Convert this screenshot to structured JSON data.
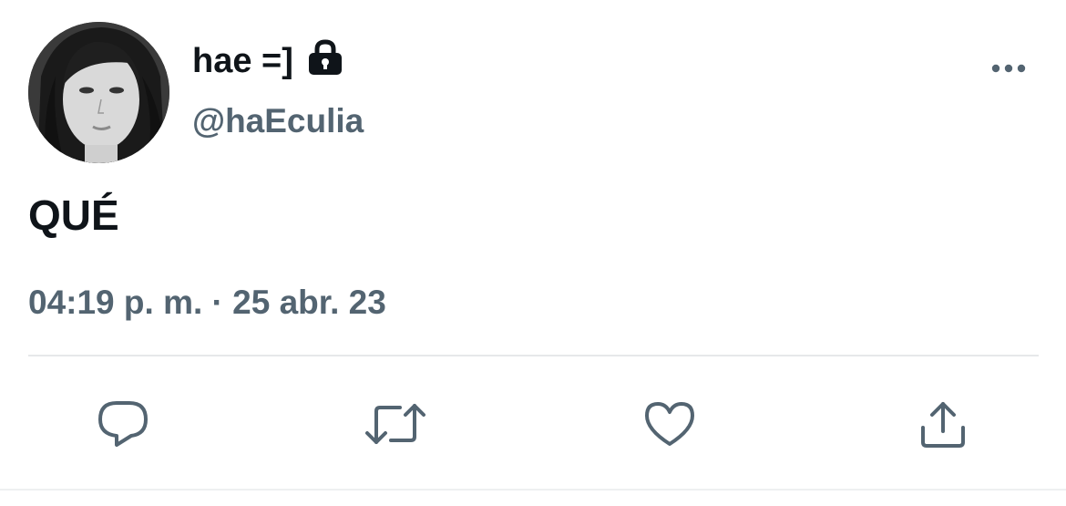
{
  "tweet": {
    "author": {
      "display_name": "hae =]",
      "handle": "@haEculia",
      "protected_icon": "lock-icon",
      "avatar": "profile-avatar"
    },
    "text": "QUÉ",
    "timestamp": "04:19 p. m. · 25 abr. 23",
    "more_icon": "more-horizontal-icon"
  },
  "actions": [
    {
      "name": "reply",
      "icon": "reply-icon"
    },
    {
      "name": "retweet",
      "icon": "retweet-icon"
    },
    {
      "name": "like",
      "icon": "heart-icon"
    },
    {
      "name": "share",
      "icon": "share-icon"
    }
  ],
  "colors": {
    "text_primary": "#0f1419",
    "text_secondary": "#536471",
    "divider": "#e6e8ea"
  }
}
